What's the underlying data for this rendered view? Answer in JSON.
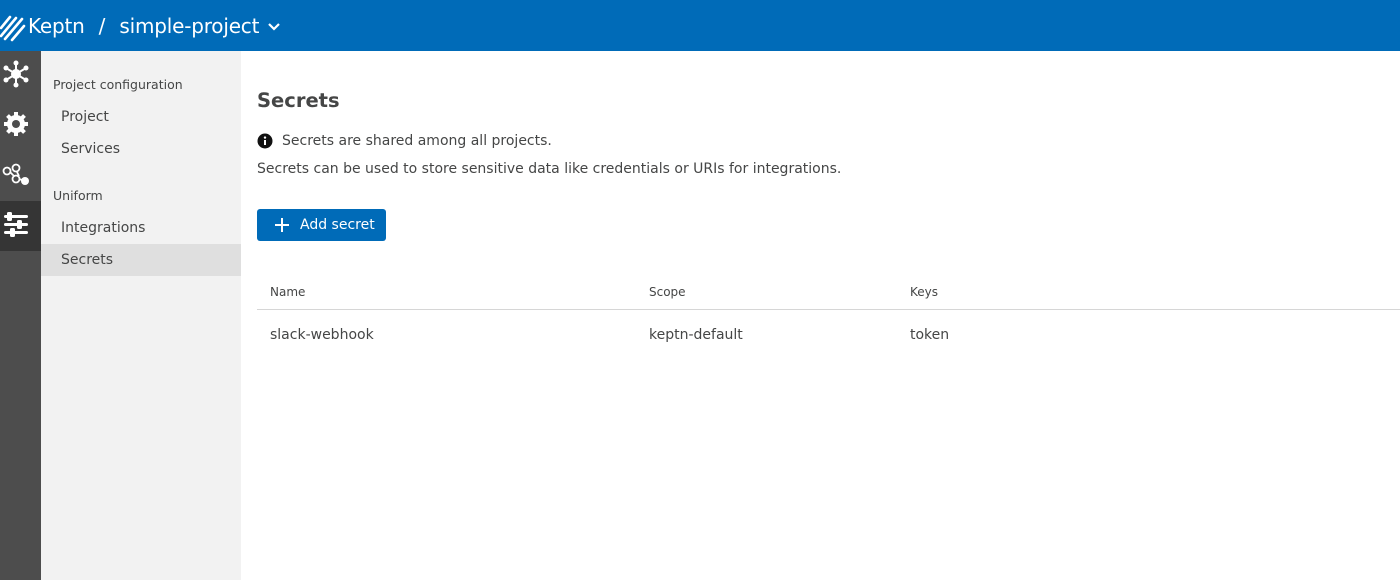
{
  "header": {
    "brand": "Keptn",
    "separator": "/",
    "project": "simple-project",
    "bg_color": "#006bb8"
  },
  "rail": {
    "items": [
      {
        "icon": "environment-icon"
      },
      {
        "icon": "gear-icon"
      },
      {
        "icon": "sequences-icon"
      },
      {
        "icon": "settings-sliders-icon",
        "active": true
      }
    ]
  },
  "subnav": {
    "groups": [
      {
        "title": "Project configuration",
        "items": [
          "Project",
          "Services"
        ]
      },
      {
        "title": "Uniform",
        "items": [
          "Integrations",
          "Secrets"
        ]
      }
    ],
    "active_item": "Secrets"
  },
  "main": {
    "title": "Secrets",
    "info": "Secrets are shared among all projects.",
    "description": "Secrets can be used to store sensitive data like credentials or URIs for integrations.",
    "add_button": "Add secret",
    "table": {
      "headers": [
        "Name",
        "Scope",
        "Keys"
      ],
      "rows": [
        [
          "slack-webhook",
          "keptn-default",
          "token"
        ]
      ]
    }
  }
}
